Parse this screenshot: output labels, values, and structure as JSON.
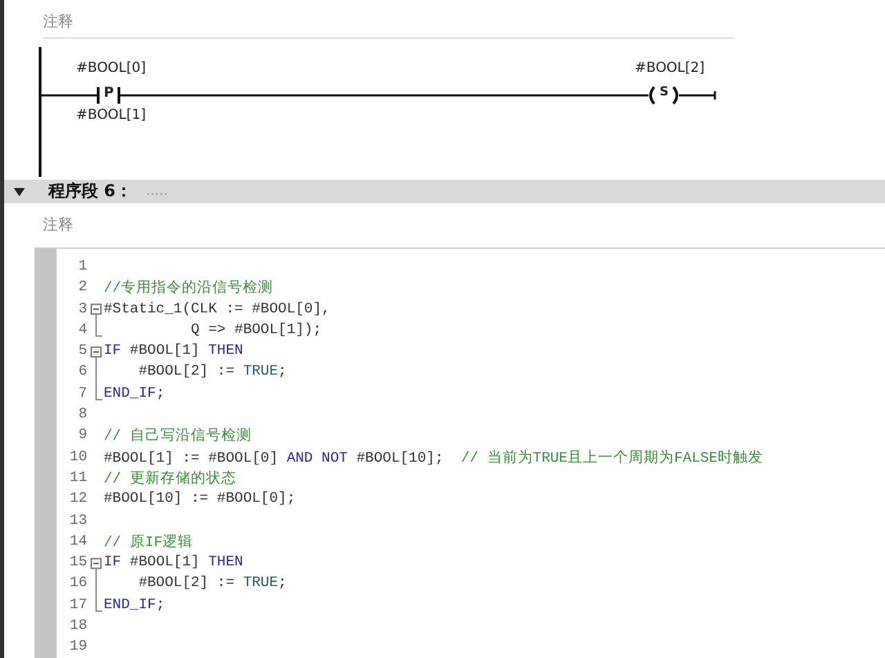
{
  "top_comment": "注释",
  "ladder": {
    "contact": {
      "operand": "#BOOL[0]",
      "type": "P",
      "memory": "#BOOL[1]"
    },
    "coil": {
      "operand": "#BOOL[2]",
      "type": "S"
    }
  },
  "network": {
    "title": "程序段 6：",
    "title_comment": ".....",
    "expanded": true,
    "comment": "注释"
  },
  "code_lines": [
    {
      "number": "1",
      "kind": "code"
    },
    {
      "number": "2",
      "kind": "code",
      "tokens": [
        {
          "kind": "comment",
          "text": "//专用指令的沿信号检测"
        }
      ]
    },
    {
      "number": "3",
      "kind": "foldstart",
      "tokens": [
        {
          "kind": "plain",
          "text": "#Static_1(CLK := #BOOL[0],"
        }
      ]
    },
    {
      "number": "4",
      "kind": "foldend",
      "tokens": [
        {
          "kind": "plain",
          "text": "          Q => #BOOL[1]);"
        }
      ]
    },
    {
      "number": "5",
      "kind": "foldstart",
      "tokens": [
        {
          "kind": "keyword",
          "text": "IF"
        },
        {
          "kind": "plain",
          "text": " #BOOL[1] "
        },
        {
          "kind": "keyword",
          "text": "THEN"
        }
      ]
    },
    {
      "number": "6",
      "kind": "foldbody",
      "tokens": [
        {
          "kind": "plain",
          "text": "    #BOOL[2] := "
        },
        {
          "kind": "constant",
          "text": "TRUE"
        },
        {
          "kind": "plain",
          "text": ";"
        }
      ]
    },
    {
      "number": "7",
      "kind": "foldend",
      "tokens": [
        {
          "kind": "keyword",
          "text": "END_IF"
        },
        {
          "kind": "plain",
          "text": ";"
        }
      ]
    },
    {
      "number": "8",
      "kind": "code"
    },
    {
      "number": "9",
      "kind": "code",
      "tokens": [
        {
          "kind": "comment",
          "text": "// 自己写沿信号检测"
        }
      ]
    },
    {
      "number": "10",
      "kind": "code",
      "tokens": [
        {
          "kind": "plain",
          "text": "#BOOL[1] := #BOOL[0] "
        },
        {
          "kind": "keyword",
          "text": "AND NOT"
        },
        {
          "kind": "plain",
          "text": " #BOOL[10];  "
        },
        {
          "kind": "comment",
          "text": "// 当前为TRUE且上一个周期为FALSE时触发"
        }
      ]
    },
    {
      "number": "11",
      "kind": "code",
      "tokens": [
        {
          "kind": "comment",
          "text": "// 更新存储的状态"
        }
      ]
    },
    {
      "number": "12",
      "kind": "code",
      "tokens": [
        {
          "kind": "plain",
          "text": "#BOOL[10] := #BOOL[0];"
        }
      ]
    },
    {
      "number": "13",
      "kind": "code"
    },
    {
      "number": "14",
      "kind": "code",
      "tokens": [
        {
          "kind": "comment",
          "text": "// 原IF逻辑"
        }
      ]
    },
    {
      "number": "15",
      "kind": "foldstart",
      "tokens": [
        {
          "kind": "keyword",
          "text": "IF"
        },
        {
          "kind": "plain",
          "text": " #BOOL[1] "
        },
        {
          "kind": "keyword",
          "text": "THEN"
        }
      ]
    },
    {
      "number": "16",
      "kind": "foldbody",
      "tokens": [
        {
          "kind": "plain",
          "text": "    #BOOL[2] := "
        },
        {
          "kind": "constant",
          "text": "TRUE"
        },
        {
          "kind": "plain",
          "text": ";"
        }
      ]
    },
    {
      "number": "17",
      "kind": "foldend",
      "tokens": [
        {
          "kind": "keyword",
          "text": "END_IF"
        },
        {
          "kind": "plain",
          "text": ";"
        }
      ]
    },
    {
      "number": "18",
      "kind": "code"
    },
    {
      "number": "19",
      "kind": "code"
    }
  ]
}
